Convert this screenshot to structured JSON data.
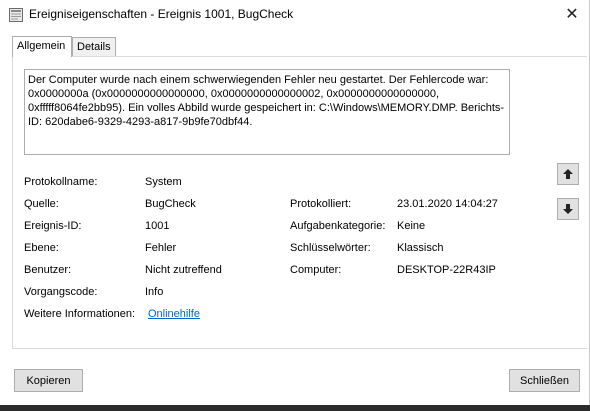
{
  "window": {
    "title": "Ereigniseigenschaften - Ereignis 1001, BugCheck",
    "close_glyph": "✕"
  },
  "tabs": [
    {
      "label": "Allgemein",
      "active": true
    },
    {
      "label": "Details",
      "active": false
    }
  ],
  "description": "Der Computer wurde nach einem schwerwiegenden Fehler neu gestartet. Der Fehlercode war: 0x0000000a (0x0000000000000000, 0x0000000000000002, 0x0000000000000000, 0xfffff8064fe2bb95). Ein volles Abbild wurde gespeichert in: C:\\Windows\\MEMORY.DMP. Berichts-ID: 620dabe6-9329-4293-a817-9b9fe70dbf44.",
  "fields": {
    "protokollname": {
      "label": "Protokollname:",
      "value": "System"
    },
    "quelle": {
      "label": "Quelle:",
      "value": "BugCheck"
    },
    "protokolliert": {
      "label": "Protokolliert:",
      "value": "23.01.2020 14:04:27"
    },
    "ereignis_id": {
      "label": "Ereignis-ID:",
      "value": "1001"
    },
    "aufgabenkategorie": {
      "label": "Aufgabenkategorie:",
      "value": "Keine"
    },
    "ebene": {
      "label": "Ebene:",
      "value": "Fehler"
    },
    "schluesselwoerter": {
      "label": "Schlüsselwörter:",
      "value": "Klassisch"
    },
    "benutzer": {
      "label": "Benutzer:",
      "value": "Nicht zutreffend"
    },
    "computer": {
      "label": "Computer:",
      "value": "DESKTOP-22R43IP"
    },
    "vorgangscode": {
      "label": "Vorgangscode:",
      "value": "Info"
    },
    "weitere_informationen": {
      "label": "Weitere Informationen:",
      "link_text": "Onlinehilfe"
    }
  },
  "side_buttons": {
    "up_icon": "arrow-up-icon",
    "down_icon": "arrow-down-icon"
  },
  "buttons": {
    "copy_label": "Kopieren",
    "close_label": "Schließen"
  }
}
